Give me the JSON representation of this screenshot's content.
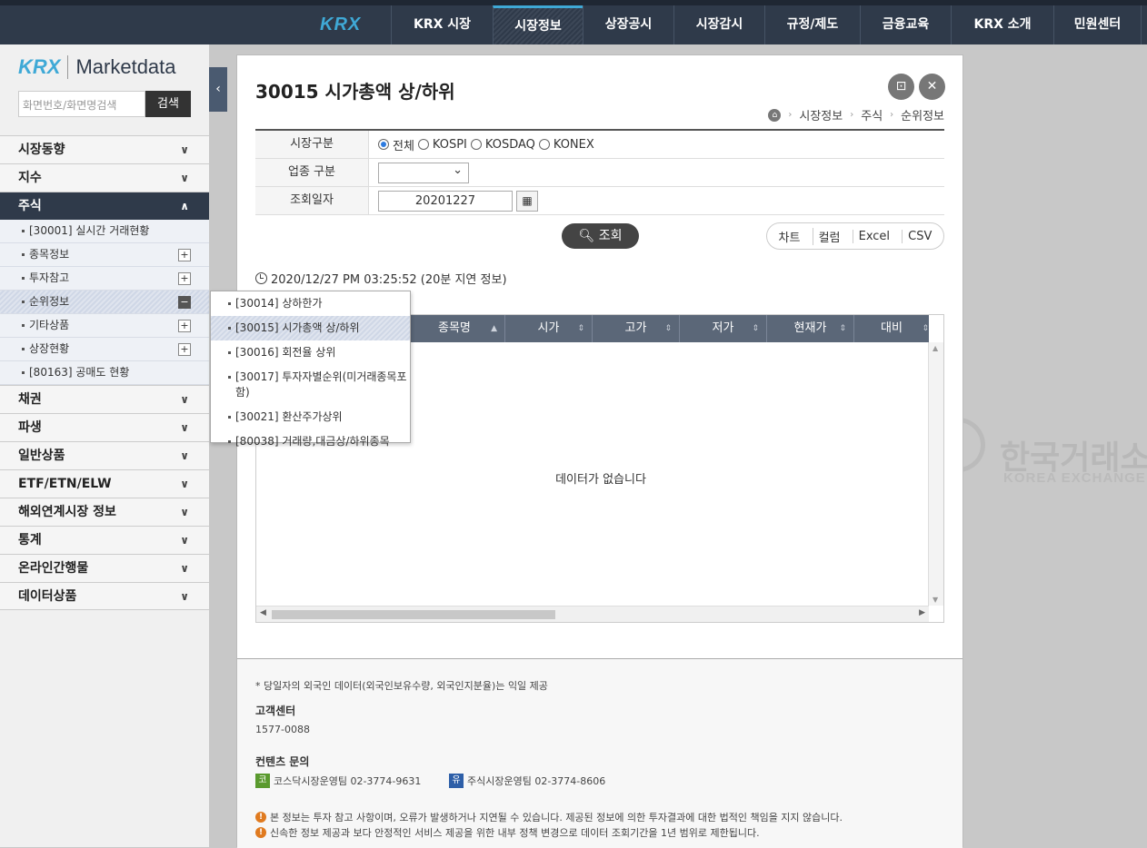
{
  "topnav": {
    "logo": "KRX",
    "items": [
      "KRX 시장",
      "시장정보",
      "상장공시",
      "시장감시",
      "규정/제도",
      "금융교육",
      "KRX 소개",
      "민원센터"
    ]
  },
  "sidebar": {
    "logo_krx": "KRX",
    "logo_title": "Marketdata",
    "search_placeholder": "화면번호/화면명검색",
    "search_button": "검색",
    "menu": {
      "m1": "시장동향",
      "m2": "지수",
      "m3": "주식",
      "sub1": "[30001] 실시간 거래현황",
      "sub2": "종목정보",
      "sub3": "투자참고",
      "sub4": "순위정보",
      "sub5": "기타상품",
      "sub6": "상장현황",
      "sub7": "[80163] 공매도 현황",
      "m4": "채권",
      "m5": "파생",
      "m6": "일반상품",
      "m7": "ETF/ETN/ELW",
      "m8": "해외연계시장 정보",
      "m9": "통계",
      "m10": "온라인간행물",
      "m11": "데이터상품"
    }
  },
  "popup": {
    "items": [
      "[30014] 상하한가",
      "[30015] 시가총액 상/하위",
      "[30016] 회전율 상위",
      "[30017] 투자자별순위(미거래종목포함)",
      "[30021] 환산주가상위",
      "[80038] 거래량,대금상/하위종목"
    ]
  },
  "page": {
    "title": "30015 시가총액 상/하위",
    "breadcrumb": [
      "시장정보",
      "주식",
      "순위정보"
    ]
  },
  "form": {
    "market_label": "시장구분",
    "market_options": [
      "전체",
      "KOSPI",
      "KOSDAQ",
      "KONEX"
    ],
    "market_selected": "전체",
    "sector_label": "업종 구분",
    "date_label": "조회일자",
    "date_value": "20201227"
  },
  "actions": {
    "search": "조회",
    "tools": [
      "차트",
      "컬럼",
      "Excel",
      "CSV"
    ]
  },
  "timestamp": "2020/12/27 PM 03:25:52 (20분 지연 정보)",
  "grid": {
    "columns": [
      "종목명",
      "시가",
      "고가",
      "저가",
      "현재가",
      "대비"
    ],
    "empty": "데이터가 없습니다"
  },
  "footer": {
    "note": "* 당일자의 외국인 데이터(외국인보유수량, 외국인지분율)는 익일 제공",
    "cs_title": "고객센터",
    "cs_phone": "1577-0088",
    "contact_title": "컨텐츠 문의",
    "kosdaq_badge": "코",
    "kosdaq_contact": "코스닥시장운영팀 02-3774-9631",
    "stock_badge": "유",
    "stock_contact": "주식시장운영팀 02-3774-8606",
    "warn1": "본 정보는 투자 참고 사항이며, 오류가 발생하거나 지연될 수 있습니다. 제공된 정보에 의한 투자결과에 대한 법적인 책임을 지지 않습니다.",
    "warn2": "신속한 정보 제공과 보다 안정적인 서비스 제공을 위한 내부 정책 변경으로 데이터 조회기간을 1년 범위로 제한됩니다."
  },
  "watermark": {
    "ko": "한국거래소",
    "en": "KOREA EXCHANGE"
  }
}
